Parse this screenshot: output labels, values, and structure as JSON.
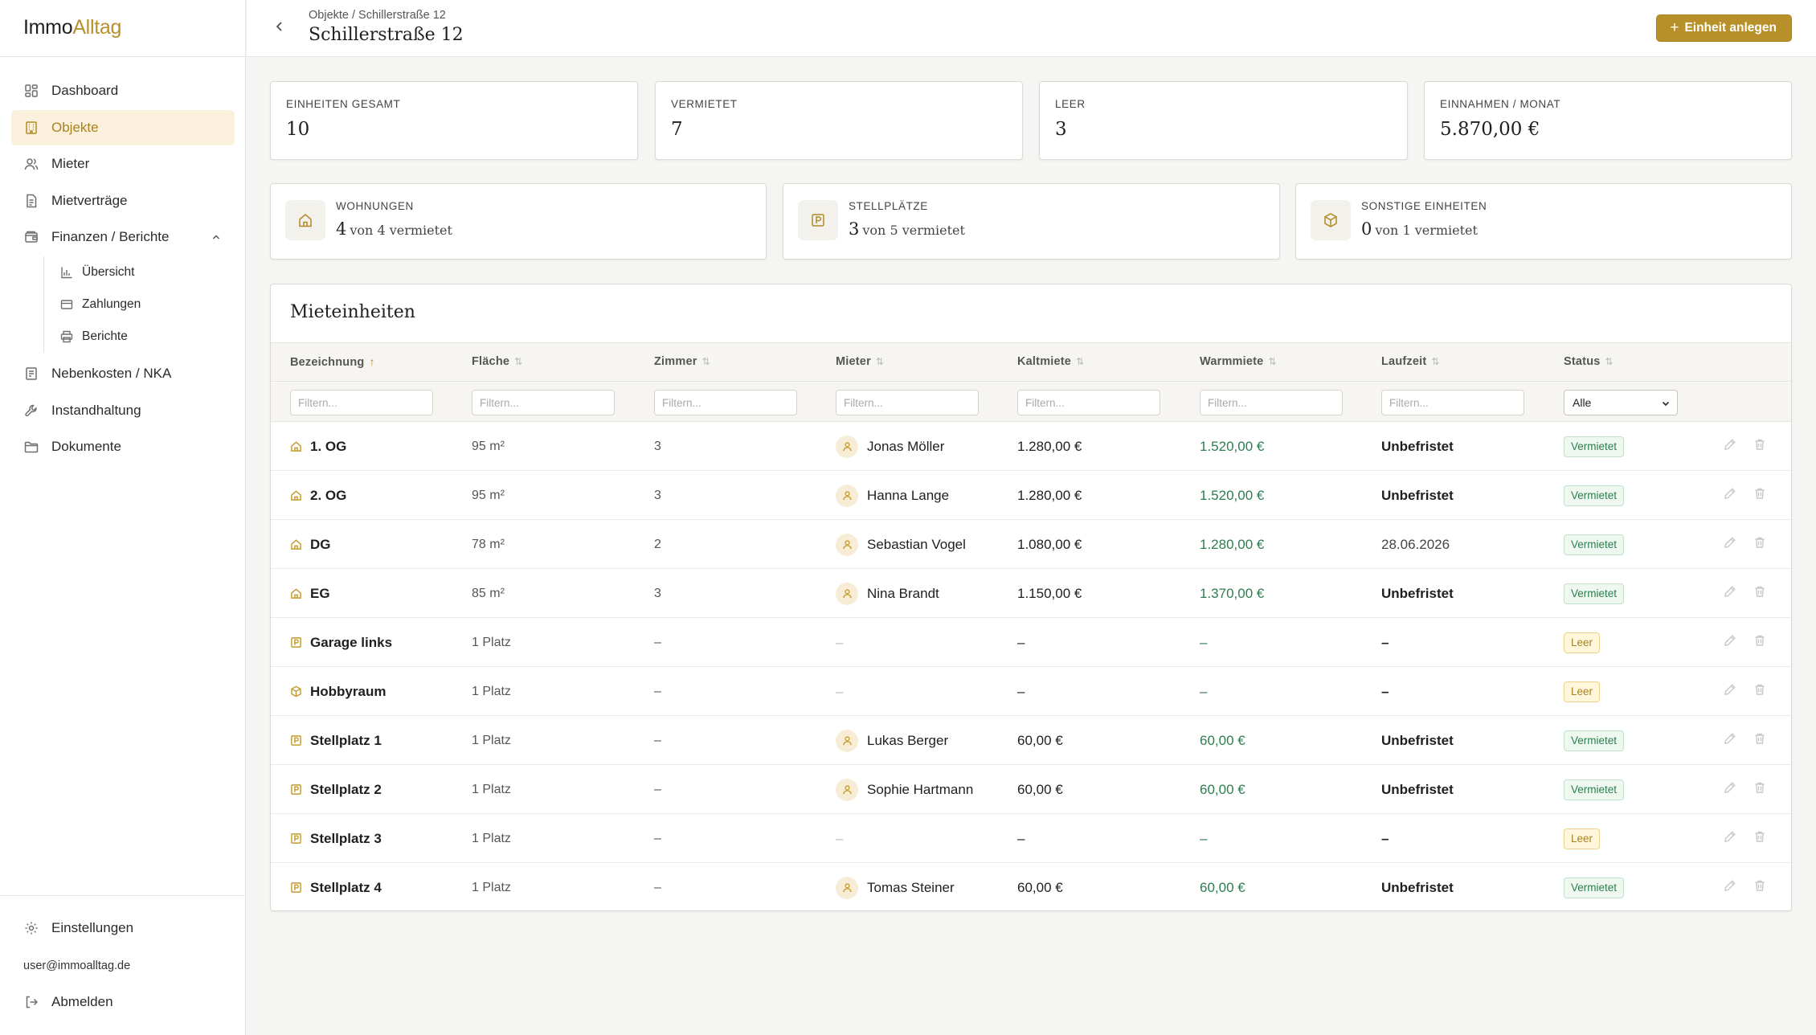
{
  "app": {
    "logo_part1": "Immo",
    "logo_part2": "Alltag"
  },
  "sidebar": {
    "items": [
      {
        "label": "Dashboard",
        "icon": "dashboard-icon"
      },
      {
        "label": "Objekte",
        "icon": "building-icon",
        "active": true
      },
      {
        "label": "Mieter",
        "icon": "users-icon"
      },
      {
        "label": "Mietverträge",
        "icon": "document-icon"
      },
      {
        "label": "Finanzen / Berichte",
        "icon": "wallet-icon",
        "expanded": true
      },
      {
        "label": "Nebenkosten / NKA",
        "icon": "receipt-icon"
      },
      {
        "label": "Instandhaltung",
        "icon": "wrench-icon"
      },
      {
        "label": "Dokumente",
        "icon": "folder-icon"
      }
    ],
    "finance_sub": [
      {
        "label": "Übersicht",
        "icon": "bar-chart-icon"
      },
      {
        "label": "Zahlungen",
        "icon": "credit-card-icon"
      },
      {
        "label": "Berichte",
        "icon": "printer-icon"
      }
    ],
    "settings_label": "Einstellungen",
    "user_email": "user@immoalltag.de",
    "logout_label": "Abmelden"
  },
  "header": {
    "breadcrumb": "Objekte / Schillerstraße 12",
    "title": "Schillerstraße 12",
    "add_button": "Einheit anlegen"
  },
  "stats": [
    {
      "label": "EINHEITEN GESAMT",
      "value": "10"
    },
    {
      "label": "VERMIETET",
      "value": "7"
    },
    {
      "label": "LEER",
      "value": "3"
    },
    {
      "label": "EINNAHMEN / MONAT",
      "value": "5.870,00 €"
    }
  ],
  "types": [
    {
      "label": "WOHNUNGEN",
      "num": "4",
      "rest": "von 4 vermietet",
      "icon": "home-icon"
    },
    {
      "label": "STELLPLÄTZE",
      "num": "3",
      "rest": "von 5 vermietet",
      "icon": "parking-icon"
    },
    {
      "label": "SONSTIGE EINHEITEN",
      "num": "0",
      "rest": "von 1 vermietet",
      "icon": "box-icon"
    }
  ],
  "table": {
    "title": "Mieteinheiten",
    "columns": [
      "Bezeichnung",
      "Fläche",
      "Zimmer",
      "Mieter",
      "Kaltmiete",
      "Warmmiete",
      "Laufzeit",
      "Status"
    ],
    "filter_placeholder": "Filtern...",
    "status_filter": "Alle",
    "rows": [
      {
        "type": "home",
        "name": "1. OG",
        "area": "95 m²",
        "rooms": "3",
        "tenant": "Jonas Möller",
        "cold": "1.280,00 €",
        "warm": "1.520,00 €",
        "term": "Unbefristet",
        "status": "Vermietet"
      },
      {
        "type": "home",
        "name": "2. OG",
        "area": "95 m²",
        "rooms": "3",
        "tenant": "Hanna Lange",
        "cold": "1.280,00 €",
        "warm": "1.520,00 €",
        "term": "Unbefristet",
        "status": "Vermietet"
      },
      {
        "type": "home",
        "name": "DG",
        "area": "78 m²",
        "rooms": "2",
        "tenant": "Sebastian Vogel",
        "cold": "1.080,00 €",
        "warm": "1.280,00 €",
        "term": "28.06.2026",
        "status": "Vermietet"
      },
      {
        "type": "home",
        "name": "EG",
        "area": "85 m²",
        "rooms": "3",
        "tenant": "Nina Brandt",
        "cold": "1.150,00 €",
        "warm": "1.370,00 €",
        "term": "Unbefristet",
        "status": "Vermietet"
      },
      {
        "type": "parking",
        "name": "Garage links",
        "area": "1 Platz",
        "rooms": "–",
        "tenant": "",
        "cold": "–",
        "warm": "–",
        "term": "–",
        "status": "Leer"
      },
      {
        "type": "box",
        "name": "Hobbyraum",
        "area": "1 Platz",
        "rooms": "–",
        "tenant": "",
        "cold": "–",
        "warm": "–",
        "term": "–",
        "status": "Leer"
      },
      {
        "type": "parking",
        "name": "Stellplatz 1",
        "area": "1 Platz",
        "rooms": "–",
        "tenant": "Lukas Berger",
        "cold": "60,00 €",
        "warm": "60,00 €",
        "term": "Unbefristet",
        "status": "Vermietet"
      },
      {
        "type": "parking",
        "name": "Stellplatz 2",
        "area": "1 Platz",
        "rooms": "–",
        "tenant": "Sophie Hartmann",
        "cold": "60,00 €",
        "warm": "60,00 €",
        "term": "Unbefristet",
        "status": "Vermietet"
      },
      {
        "type": "parking",
        "name": "Stellplatz 3",
        "area": "1 Platz",
        "rooms": "–",
        "tenant": "",
        "cold": "–",
        "warm": "–",
        "term": "–",
        "status": "Leer"
      },
      {
        "type": "parking",
        "name": "Stellplatz 4",
        "area": "1 Platz",
        "rooms": "–",
        "tenant": "Tomas Steiner",
        "cold": "60,00 €",
        "warm": "60,00 €",
        "term": "Unbefristet",
        "status": "Vermietet"
      }
    ]
  },
  "colors": {
    "accent": "#b8902a",
    "active_bg": "#fbf0dc",
    "rented_green": "#2e7d4f",
    "empty_yellow": "#fff6dc"
  }
}
